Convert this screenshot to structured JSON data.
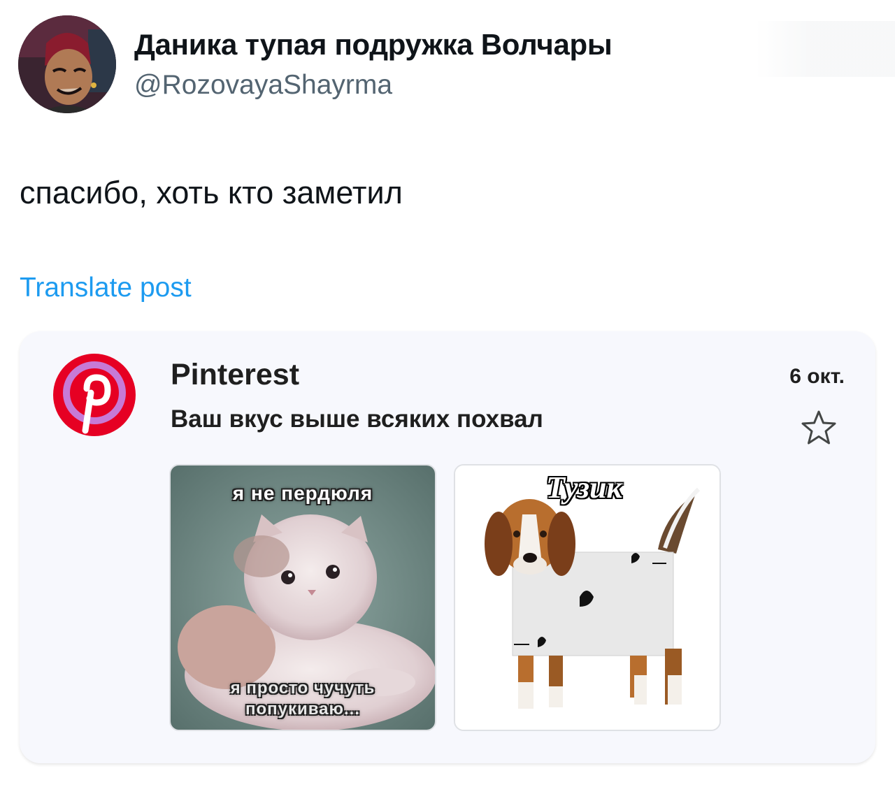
{
  "post": {
    "author": {
      "display_name": "Даника тупая подружка Волчары",
      "handle": "@RozovayaShayrma"
    },
    "text": "спасибо, хоть кто заметил",
    "translate_label": "Translate post"
  },
  "email_card": {
    "sender": "Pinterest",
    "subject": "Ваш вкус выше всяких похвал",
    "date": "6 окт.",
    "brand_color": "#e60023",
    "images": [
      {
        "caption_top": "я не пердюля",
        "caption_bottom": "я просто чучуть попукиваю..."
      },
      {
        "caption_top": "Тузик"
      }
    ]
  },
  "colors": {
    "text_primary": "#0f1419",
    "text_secondary": "#536471",
    "link": "#1d9bf0",
    "card_background": "#f7f8fd"
  },
  "icons": {
    "avatar": "cartoon-avatar",
    "sender_logo": "pinterest-logo-icon",
    "star": "star-outline-icon"
  }
}
